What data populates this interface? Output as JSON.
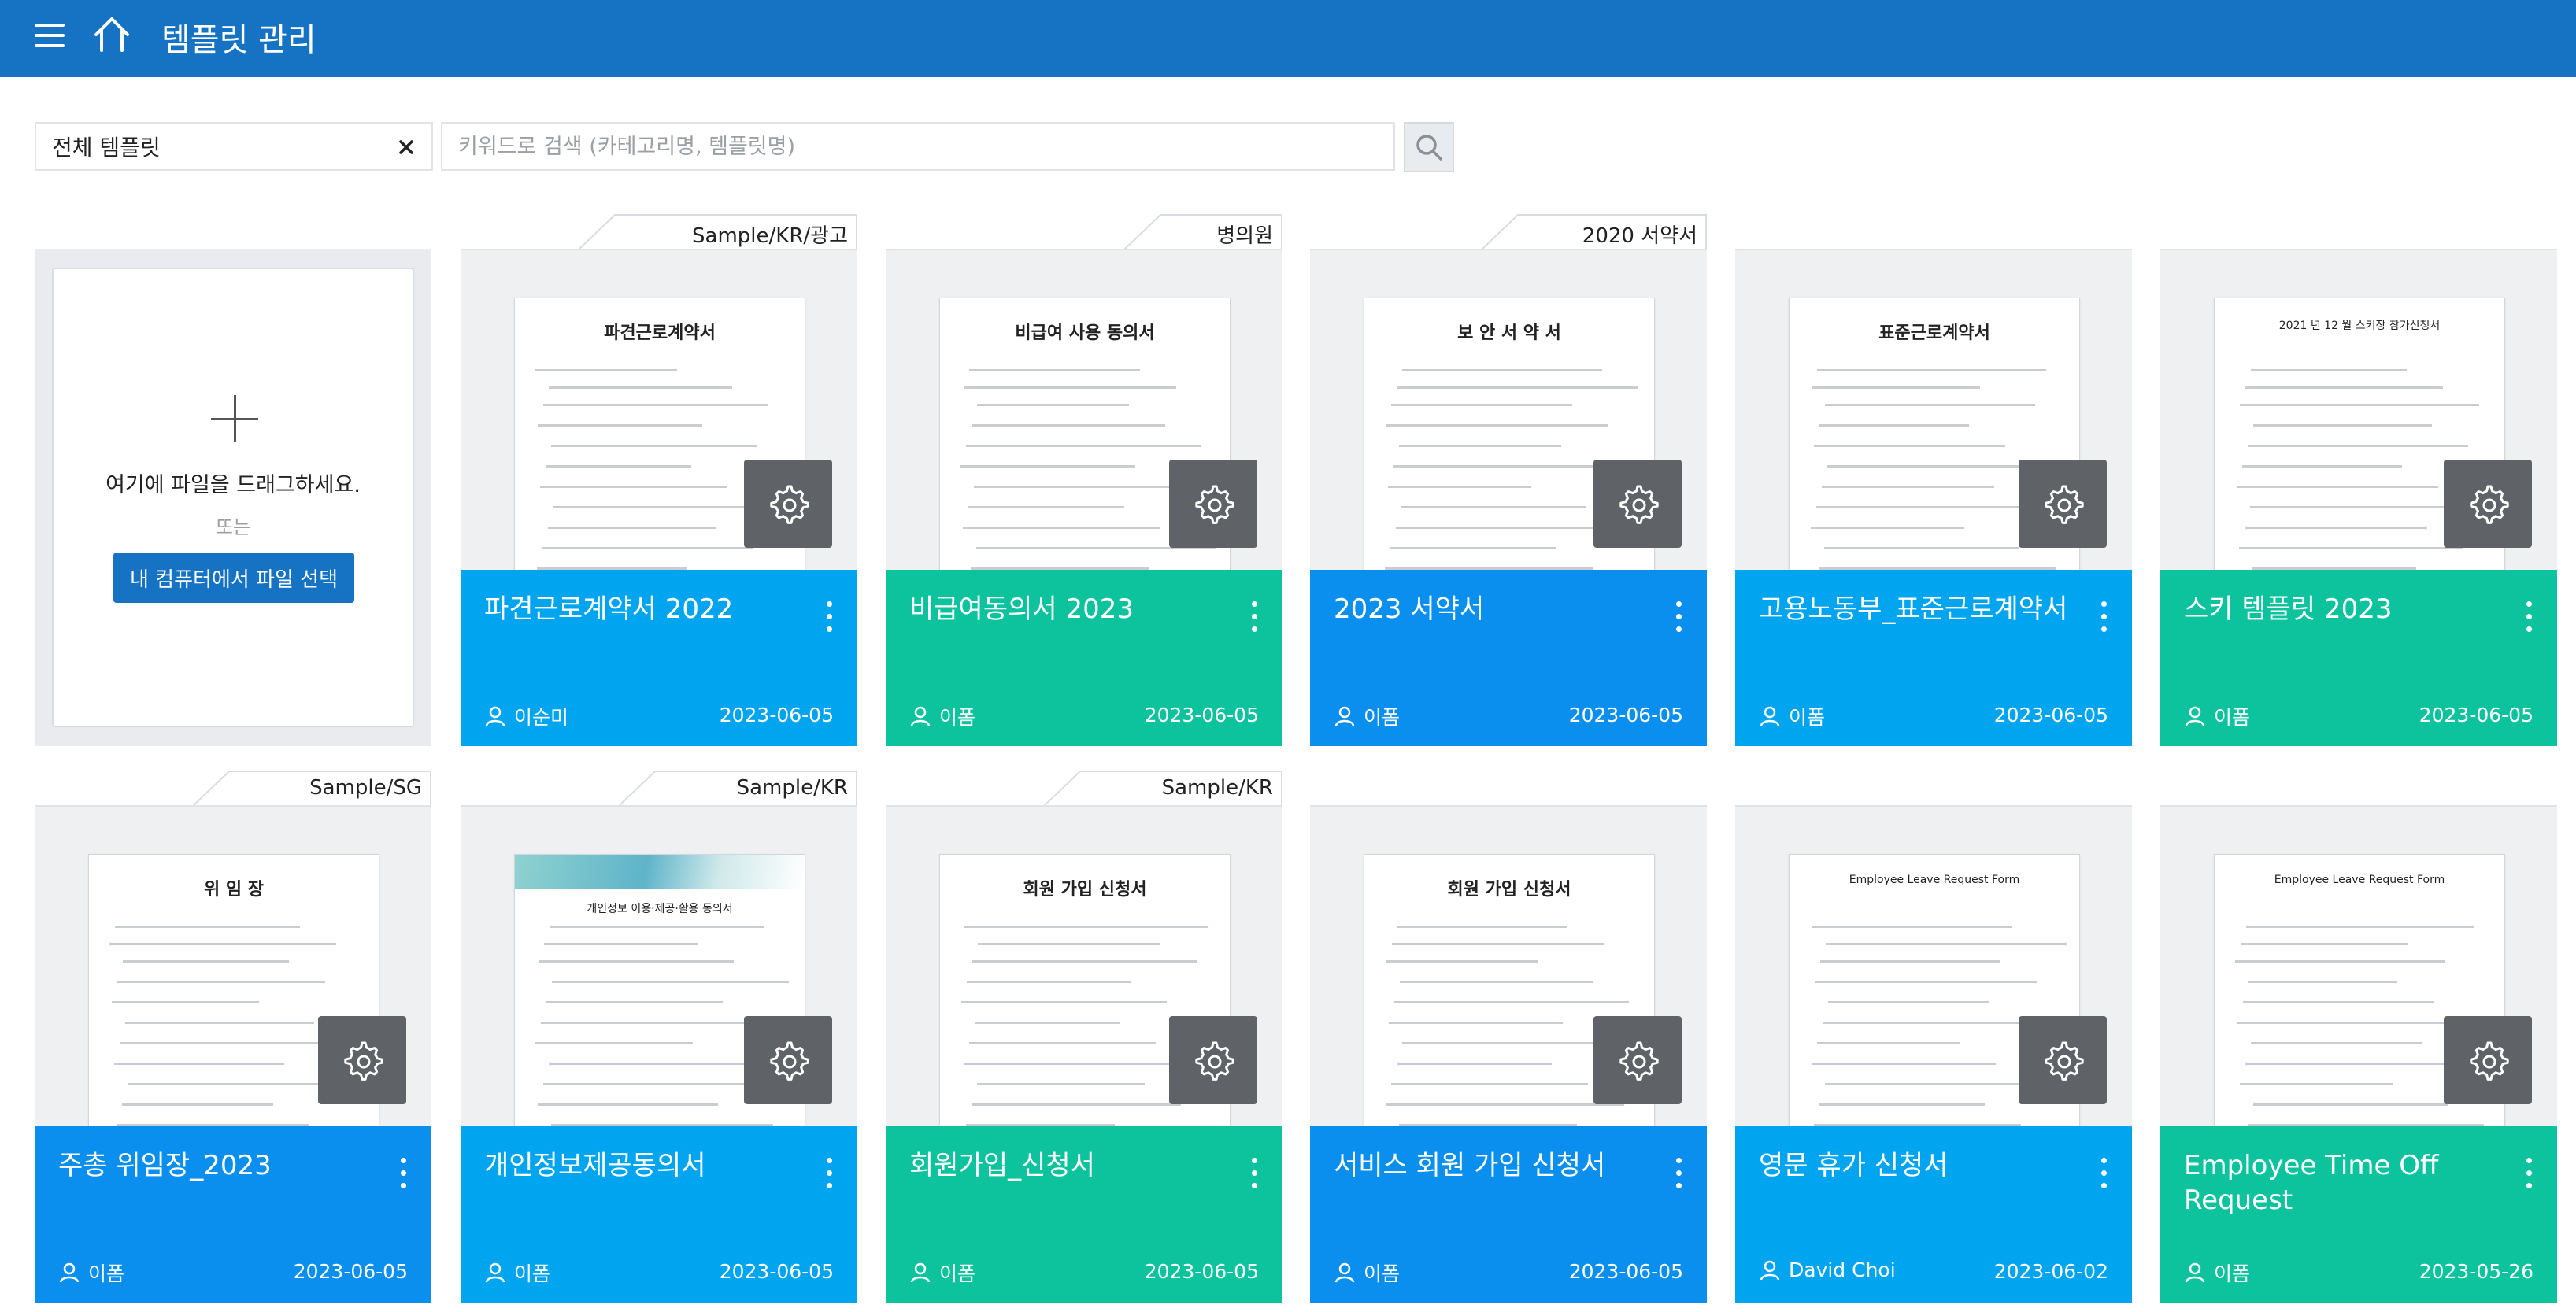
{
  "header": {
    "title": "템플릿 관리"
  },
  "filter": {
    "category_value": "전체 템플릿",
    "search_placeholder": "키워드로 검색 (카테고리명, 템플릿명)"
  },
  "upload": {
    "drop_text": "여기에 파일을 드래그하세요.",
    "or_text": "또는",
    "button_label": "내 컴퓨터에서 파일 선택"
  },
  "templates": [
    {
      "category": "Sample/KR/광고",
      "doc_title": "파견근로계약서",
      "name": "파견근로계약서 2022",
      "author": "이순미",
      "date": "2023-06-05",
      "color": "#00a4ef"
    },
    {
      "category": "병의원",
      "doc_title": "비급여 사용 동의서",
      "name": "비급여동의서 2023",
      "author": "이폼",
      "date": "2023-06-05",
      "color": "#0dc39d"
    },
    {
      "category": "2020 서약서",
      "doc_title": "보 안 서 약 서",
      "name": "2023 서약서",
      "author": "이폼",
      "date": "2023-06-05",
      "color": "#0a8fef"
    },
    {
      "category": "",
      "doc_title": "표준근로계약서",
      "name": "고용노동부_표준근로계약서",
      "author": "이폼",
      "date": "2023-06-05",
      "color": "#00a4ef"
    },
    {
      "category": "",
      "doc_title": "2021 년 12 월 스키장 참가신청서",
      "name": "스키 템플릿 2023",
      "author": "이폼",
      "date": "2023-06-05",
      "color": "#0dc39d"
    },
    {
      "category": "Sample/SG",
      "doc_title": "위 임 장",
      "name": "주총 위임장_2023",
      "author": "이폼",
      "date": "2023-06-05",
      "color": "#0a8fef"
    },
    {
      "category": "Sample/KR",
      "doc_title": "개인정보 이용·제공·활용 동의서",
      "name": "개인정보제공동의서",
      "author": "이폼",
      "date": "2023-06-05",
      "color": "#00a4ef"
    },
    {
      "category": "Sample/KR",
      "doc_title": "회원 가입 신청서",
      "name": "회원가입_신청서",
      "author": "이폼",
      "date": "2023-06-05",
      "color": "#0dc39d"
    },
    {
      "category": "",
      "doc_title": "회원 가입 신청서",
      "name": "서비스 회원 가입 신청서",
      "author": "이폼",
      "date": "2023-06-05",
      "color": "#0a8fef"
    },
    {
      "category": "",
      "doc_title": "Employee Leave Request Form",
      "name": "영문 휴가 신청서",
      "author": "David Choi",
      "date": "2023-06-02",
      "color": "#00a4ef"
    },
    {
      "category": "",
      "doc_title": "Employee Leave Request Form",
      "name": "Employee Time Off Request",
      "author": "이폼",
      "date": "2023-05-26",
      "color": "#0dc39d"
    }
  ]
}
